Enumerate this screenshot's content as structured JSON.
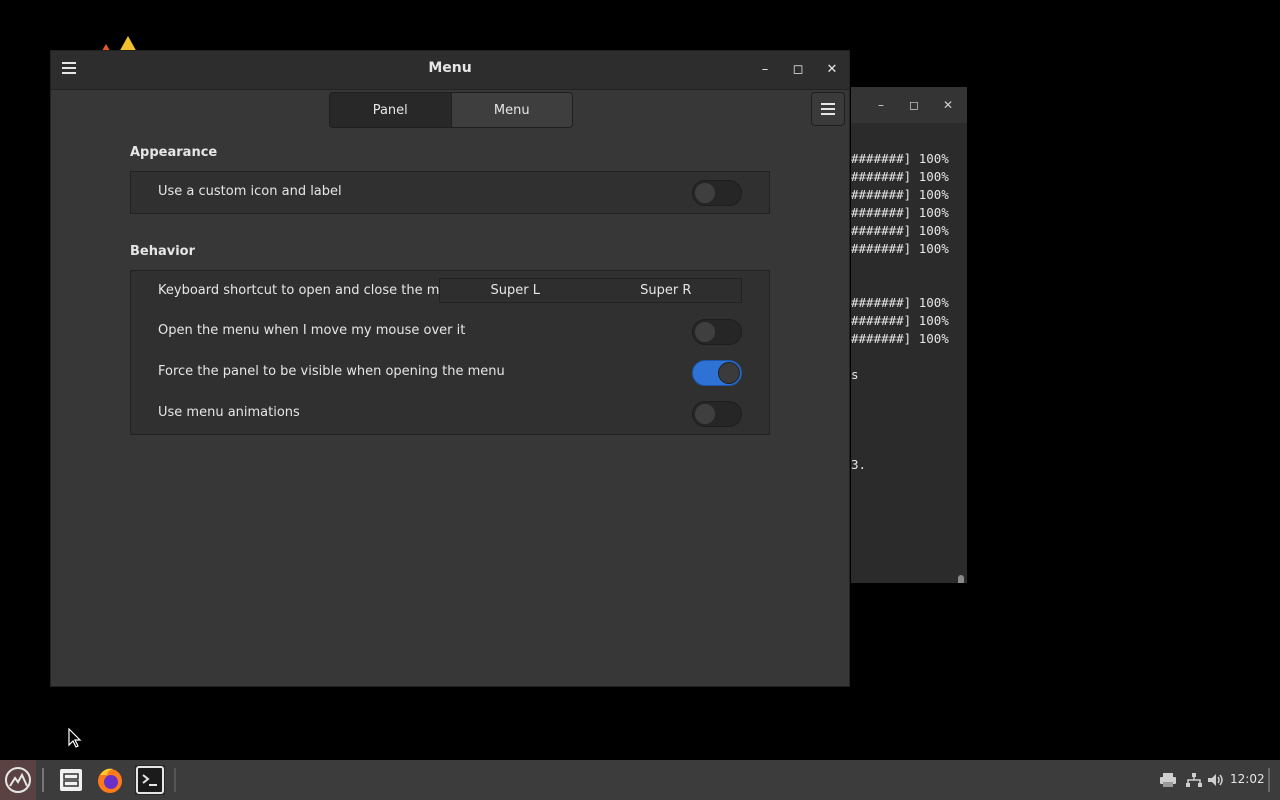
{
  "window": {
    "title": "Menu",
    "stack_tabs": [
      {
        "label": "Panel",
        "active": true
      },
      {
        "label": "Menu",
        "active": false
      }
    ]
  },
  "appearance": {
    "title": "Appearance",
    "rows": [
      {
        "label": "Use a custom icon and label",
        "toggle_on": false
      }
    ]
  },
  "behavior": {
    "title": "Behavior",
    "shortcut": {
      "label": "Keyboard shortcut to open and close the menu",
      "key1": "Super L",
      "key2": "Super R"
    },
    "rows": [
      {
        "label": "Open the menu when I move my mouse over it",
        "toggle_on": false
      },
      {
        "label": "Force the panel to be visible when opening the menu",
        "toggle_on": true
      },
      {
        "label": "Use menu animations",
        "toggle_on": false
      }
    ]
  },
  "terminal": {
    "lines": [
      "#######] 100%",
      "#######] 100%",
      "#######] 100%",
      "#######] 100%",
      "#######] 100%",
      "#######] 100%",
      "#######] 100%",
      "#######] 100%",
      "#######] 100%",
      "s",
      "3."
    ]
  },
  "taskbar": {
    "clock": "12:02"
  },
  "colors": {
    "accent": "#2f72d6"
  }
}
